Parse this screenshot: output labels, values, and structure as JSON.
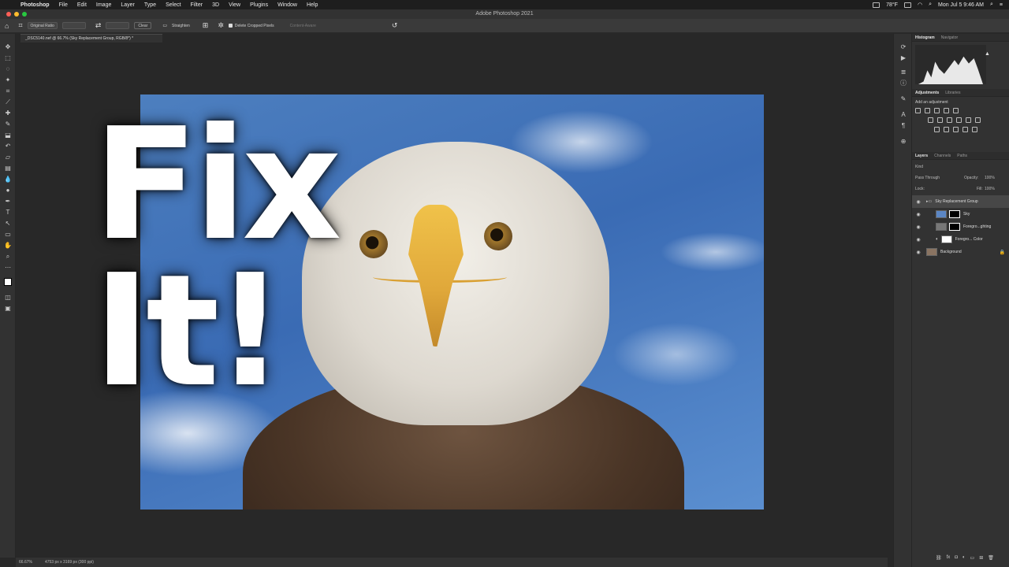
{
  "menubar": {
    "app": "Photoshop",
    "items": [
      "File",
      "Edit",
      "Image",
      "Layer",
      "Type",
      "Select",
      "Filter",
      "3D",
      "View",
      "Plugins",
      "Window",
      "Help"
    ],
    "weather": "78°F",
    "datetime": "Mon Jul 5  9:46 AM"
  },
  "window": {
    "title": "Adobe Photoshop 2021"
  },
  "options": {
    "ratio": "Original Ratio",
    "clear": "Clear",
    "straighten": "Straighten",
    "delete_cropped": "Delete Cropped Pixels",
    "content_aware": "Content-Aware"
  },
  "document": {
    "tab": "_DSC5140.nef @ 66.7% (Sky Replacement Group, RGB/8*) *",
    "overlay_text": "Fix\nIt!"
  },
  "status": {
    "zoom": "66.67%",
    "dimensions": "4753 px x 3169 px (300 ppi)"
  },
  "panels": {
    "histogram_tabs": [
      "Histogram",
      "Navigator"
    ],
    "adjustments_tabs": [
      "Adjustments",
      "Libraries"
    ],
    "adjustments_label": "Add an adjustment",
    "layers_tabs": [
      "Layers",
      "Channels",
      "Paths"
    ],
    "kind": "Kind",
    "blend": "Pass Through",
    "opacity_label": "Opacity:",
    "opacity": "100%",
    "lock_label": "Lock:",
    "fill_label": "Fill:",
    "fill": "100%",
    "layers": [
      {
        "name": "Sky Replacement Group"
      },
      {
        "name": "Sky"
      },
      {
        "name": "Foregro...ghting"
      },
      {
        "name": "Foregro... Color"
      },
      {
        "name": "Background"
      }
    ]
  }
}
